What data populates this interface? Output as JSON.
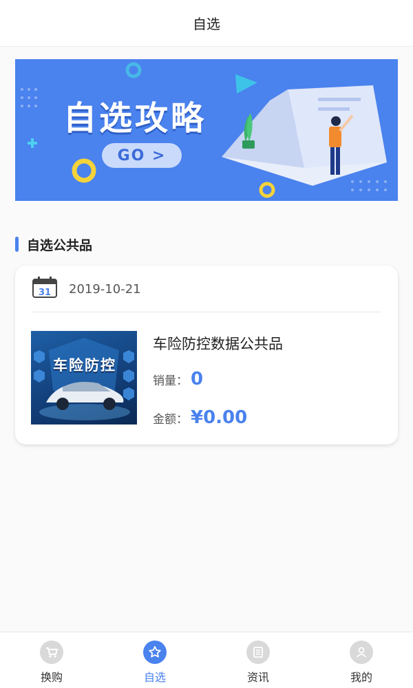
{
  "header": {
    "title": "自选"
  },
  "banner": {
    "title": "自选攻略",
    "go_label": "GO >"
  },
  "section": {
    "title": "自选公共品"
  },
  "product": {
    "date_icon_day": "31",
    "date": "2019-10-21",
    "image_title": "车险防控",
    "name": "车险防控数据公共品",
    "sales_label": "销量：",
    "sales_value": "0",
    "amount_label": "金额：",
    "amount_value": "¥0.00"
  },
  "tabs": [
    {
      "label": "换购",
      "icon": "cart-icon",
      "active": false
    },
    {
      "label": "自选",
      "icon": "star-icon",
      "active": true
    },
    {
      "label": "资讯",
      "icon": "news-icon",
      "active": false
    },
    {
      "label": "我的",
      "icon": "user-icon",
      "active": false
    }
  ],
  "colors": {
    "accent": "#4a82ee",
    "banner_bg": "#4a82ee",
    "inactive_icon": "#d9d9d9"
  }
}
